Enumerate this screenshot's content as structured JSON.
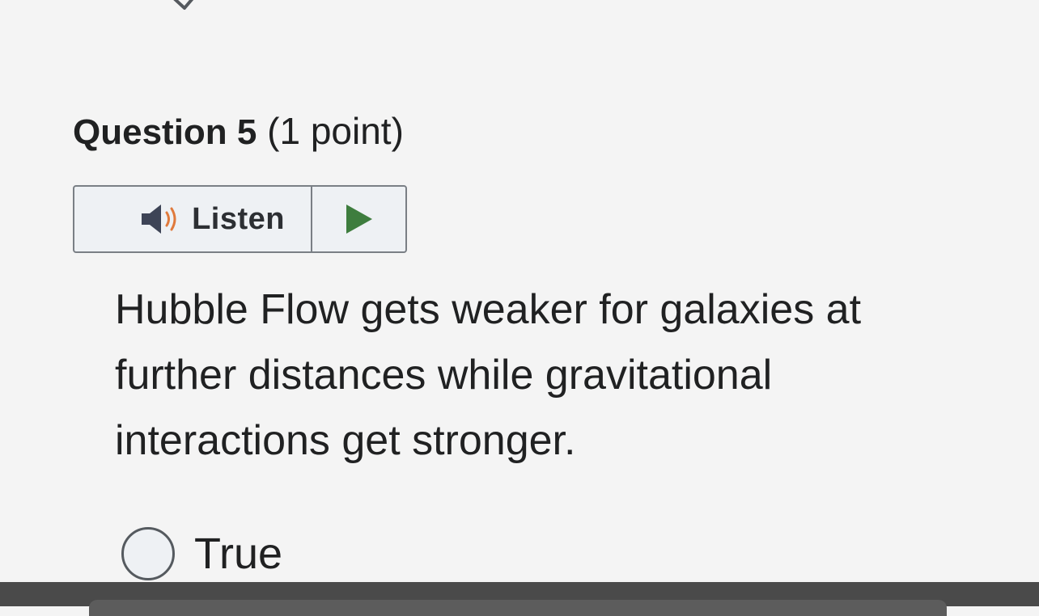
{
  "previous_item": {
    "check_icon": "checkmark-icon"
  },
  "question": {
    "title": "Question 5",
    "points": "(1 point)",
    "text": "Hubble Flow gets weaker for galaxies at further distances while gravitational interactions get stronger."
  },
  "listen": {
    "label": "Listen",
    "speaker_icon": "speaker-icon",
    "play_icon": "play-icon",
    "play_color": "#3e7d3e",
    "speaker_wave_color": "#e07a3c"
  },
  "options": [
    {
      "label": "True",
      "selected": false
    }
  ]
}
